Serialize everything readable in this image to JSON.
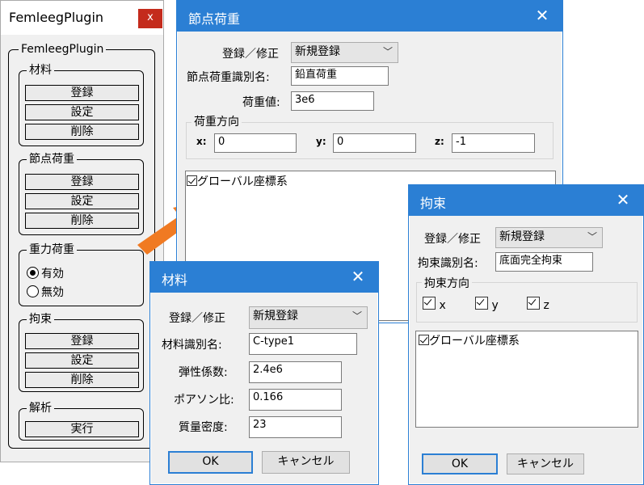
{
  "plugin_panel": {
    "title": "FemleegPlugin",
    "close": "x",
    "group_title": "FemleegPlugin",
    "material": {
      "label": "材料",
      "register": "登録",
      "settings": "設定",
      "delete": "削除"
    },
    "nodal_load": {
      "label": "節点荷重",
      "register": "登録",
      "settings": "設定",
      "delete": "削除"
    },
    "gravity": {
      "label": "重力荷重",
      "enabled": "有効",
      "disabled": "無効",
      "selected": "enabled"
    },
    "constraint": {
      "label": "拘束",
      "register": "登録",
      "settings": "設定",
      "delete": "削除"
    },
    "analysis": {
      "label": "解析",
      "run": "実行"
    }
  },
  "nodal_load_dialog": {
    "title": "節点荷重",
    "close": "✕",
    "mode_label": "登録／修正",
    "mode_value": "新規登録",
    "id_label": "節点荷重識別名:",
    "id_value": "鉛直荷重",
    "value_label": "荷重値:",
    "value_value": "3e6",
    "direction_group": "荷重方向",
    "x_label": "x:",
    "x_value": "0",
    "y_label": "y:",
    "y_value": "0",
    "z_label": "z:",
    "z_value": "-1",
    "global_coord": "グローバル座標系"
  },
  "constraint_dialog": {
    "title": "拘束",
    "close": "✕",
    "mode_label": "登録／修正",
    "mode_value": "新規登録",
    "id_label": "拘束識別名:",
    "id_value": "底面完全拘束",
    "direction_group": "拘束方向",
    "x_label": "x",
    "y_label": "y",
    "z_label": "z",
    "global_coord": "グローバル座標系",
    "ok": "OK",
    "cancel": "キャンセル"
  },
  "material_dialog": {
    "title": "材料",
    "close": "✕",
    "mode_label": "登録／修正",
    "mode_value": "新規登録",
    "id_label": "材料識別名:",
    "id_value": "C-type1",
    "elastic_label": "弾性係数:",
    "elastic_value": "2.4e6",
    "poisson_label": "ポアソン比:",
    "poisson_value": "0.166",
    "density_label": "質量密度:",
    "density_value": "23",
    "ok": "OK",
    "cancel": "キャンセル"
  },
  "colors": {
    "titlebar": "#2b7fd4",
    "plugin_close": "#c42b1c",
    "arrow": "#f07a22"
  }
}
